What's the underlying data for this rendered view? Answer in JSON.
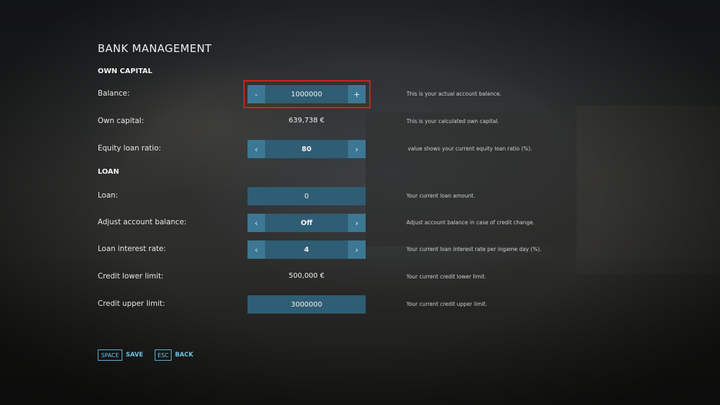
{
  "title": "BANK MANAGEMENT",
  "sections": {
    "own_capital": "OWN CAPITAL",
    "loan": "LOAN"
  },
  "rows": {
    "balance": {
      "label": "Balance:",
      "minus": "-",
      "value": "1000000",
      "plus": "+",
      "desc": "This is your actual account balance."
    },
    "own_capital": {
      "label": "Own capital:",
      "value": "639,738 €",
      "desc": "This is your calculated own capital."
    },
    "equity_ratio": {
      "label": "Equity loan ratio:",
      "left": "‹",
      "value": "80",
      "right": "›",
      "desc": "value shows your current equity loan ratio (%)."
    },
    "loan": {
      "label": "Loan:",
      "value": "0",
      "desc": "Your current loan amount."
    },
    "adjust_balance": {
      "label": "Adjust account balance:",
      "left": "‹",
      "value": "Off",
      "right": "›",
      "desc": "Adjust account balance in case of credit change."
    },
    "interest_rate": {
      "label": "Loan interest rate:",
      "left": "‹",
      "value": "4",
      "right": "›",
      "desc": "Your current loan interest rate per ingame day (%)."
    },
    "credit_lower": {
      "label": "Credit lower limit:",
      "value": "500,000 €",
      "desc": "Your current credit lower limit."
    },
    "credit_upper": {
      "label": "Credit upper limit:",
      "value": "3000000",
      "desc": "Your current credit upper limit."
    }
  },
  "footer": {
    "save_key": "SPACE",
    "save_label": "SAVE",
    "back_key": "ESC",
    "back_label": "BACK"
  },
  "colors": {
    "control_bg": "#2f5d74",
    "control_button": "#3c7894",
    "highlight": "#d41f1f",
    "key_accent": "#6fc3e6"
  }
}
